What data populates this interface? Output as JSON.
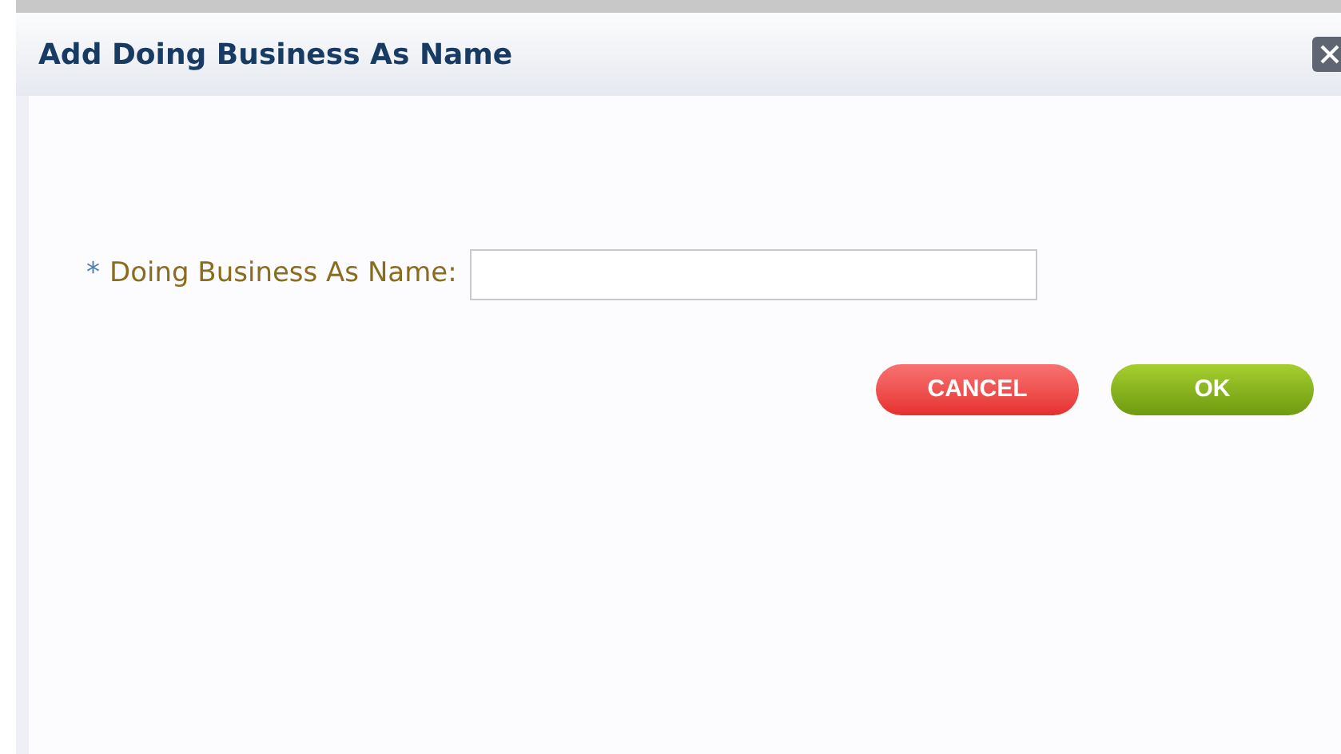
{
  "dialog": {
    "title": "Add Doing Business As Name"
  },
  "field": {
    "required_mark": "*",
    "label": "Doing Business As Name:"
  },
  "buttons": [
    {
      "label": "CANCEL",
      "kind": "cancel"
    },
    {
      "label": "OK",
      "kind": "ok"
    }
  ]
}
